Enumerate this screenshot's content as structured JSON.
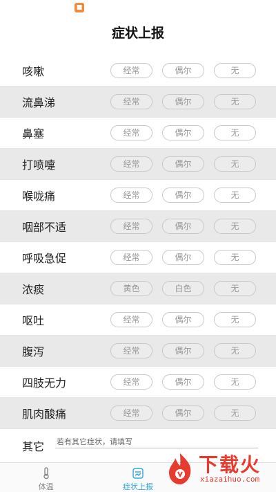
{
  "header": {
    "title": "症状上报",
    "app_icon": "app-icon"
  },
  "symptoms": [
    {
      "name": "咳嗽",
      "options": [
        "经常",
        "偶尔",
        "无"
      ]
    },
    {
      "name": "流鼻涕",
      "options": [
        "经常",
        "偶尔",
        "无"
      ]
    },
    {
      "name": "鼻塞",
      "options": [
        "经常",
        "偶尔",
        "无"
      ]
    },
    {
      "name": "打喷嚏",
      "options": [
        "经常",
        "偶尔",
        "无"
      ]
    },
    {
      "name": "喉咙痛",
      "options": [
        "经常",
        "偶尔",
        "无"
      ]
    },
    {
      "name": "咽部不适",
      "options": [
        "经常",
        "偶尔",
        "无"
      ]
    },
    {
      "name": "呼吸急促",
      "options": [
        "经常",
        "偶尔",
        "无"
      ]
    },
    {
      "name": "浓痰",
      "options": [
        "黄色",
        "白色",
        "无"
      ]
    },
    {
      "name": "呕吐",
      "options": [
        "经常",
        "偶尔",
        "无"
      ]
    },
    {
      "name": "腹泻",
      "options": [
        "经常",
        "偶尔",
        "无"
      ]
    },
    {
      "name": "四肢无力",
      "options": [
        "经常",
        "偶尔",
        "无"
      ]
    },
    {
      "name": "肌肉酸痛",
      "options": [
        "经常",
        "偶尔",
        "无"
      ]
    }
  ],
  "other": {
    "label": "其它",
    "placeholder": "若有其它症状，请填写"
  },
  "tabbar": {
    "tabs": [
      {
        "label": "体温",
        "icon": "thermometer-icon"
      },
      {
        "label": "症状上报",
        "icon": "report-icon"
      },
      {
        "label": "",
        "icon": ""
      }
    ],
    "active_color": "#2ea7e0"
  },
  "watermark": {
    "text": "下载火",
    "url": "xiazaihuo.com",
    "color": "#e63b2e"
  }
}
